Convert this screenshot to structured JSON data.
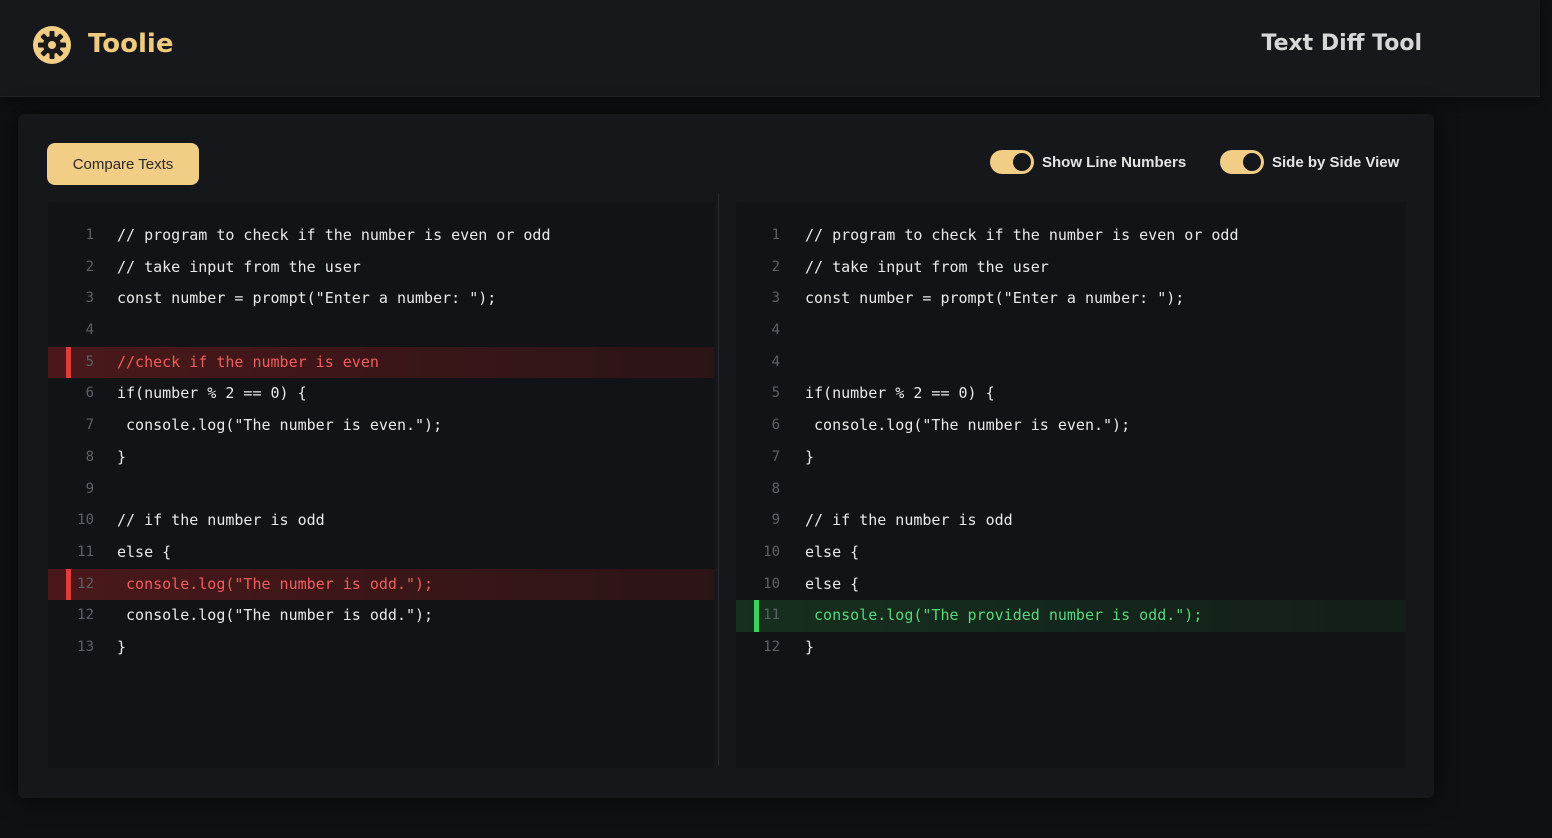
{
  "header": {
    "brand": "Toolie",
    "page_title": "Text Diff Tool",
    "logo_icon": "gear-icon"
  },
  "toolbar": {
    "compare_label": "Compare Texts",
    "show_line_numbers_label": "Show Line Numbers",
    "show_line_numbers_on": true,
    "side_by_side_label": "Side by Side View",
    "side_by_side_on": true
  },
  "colors": {
    "accent": "#f1cd86",
    "removed": "#f15c5c",
    "added": "#56d77a"
  },
  "left_pane": {
    "lines": [
      {
        "num": "1",
        "text": "// program to check if the number is even or odd",
        "state": "normal"
      },
      {
        "num": "2",
        "text": "// take input from the user",
        "state": "normal"
      },
      {
        "num": "3",
        "text": "const number = prompt(\"Enter a number: \");",
        "state": "normal"
      },
      {
        "num": "4",
        "text": "",
        "state": "normal"
      },
      {
        "num": "5",
        "text": "//check if the number is even",
        "state": "removed"
      },
      {
        "num": "6",
        "text": "if(number % 2 == 0) {",
        "state": "normal"
      },
      {
        "num": "7",
        "text": " console.log(\"The number is even.\");",
        "state": "normal"
      },
      {
        "num": "8",
        "text": "}",
        "state": "normal"
      },
      {
        "num": "9",
        "text": "",
        "state": "normal"
      },
      {
        "num": "10",
        "text": "// if the number is odd",
        "state": "normal"
      },
      {
        "num": "11",
        "text": "else {",
        "state": "normal"
      },
      {
        "num": "12",
        "text": " console.log(\"The number is odd.\");",
        "state": "removed"
      },
      {
        "num": "12",
        "text": " console.log(\"The number is odd.\");",
        "state": "normal"
      },
      {
        "num": "13",
        "text": "}",
        "state": "normal"
      }
    ]
  },
  "right_pane": {
    "lines": [
      {
        "num": "1",
        "text": "// program to check if the number is even or odd",
        "state": "normal"
      },
      {
        "num": "2",
        "text": "// take input from the user",
        "state": "normal"
      },
      {
        "num": "3",
        "text": "const number = prompt(\"Enter a number: \");",
        "state": "normal"
      },
      {
        "num": "4",
        "text": "",
        "state": "normal"
      },
      {
        "num": "4",
        "text": "",
        "state": "normal"
      },
      {
        "num": "5",
        "text": "if(number % 2 == 0) {",
        "state": "normal"
      },
      {
        "num": "6",
        "text": " console.log(\"The number is even.\");",
        "state": "normal"
      },
      {
        "num": "7",
        "text": "}",
        "state": "normal"
      },
      {
        "num": "8",
        "text": "",
        "state": "normal"
      },
      {
        "num": "9",
        "text": "// if the number is odd",
        "state": "normal"
      },
      {
        "num": "10",
        "text": "else {",
        "state": "normal"
      },
      {
        "num": "10",
        "text": "else {",
        "state": "normal"
      },
      {
        "num": "11",
        "text": " console.log(\"The provided number is odd.\");",
        "state": "added"
      },
      {
        "num": "12",
        "text": "}",
        "state": "normal"
      }
    ]
  }
}
